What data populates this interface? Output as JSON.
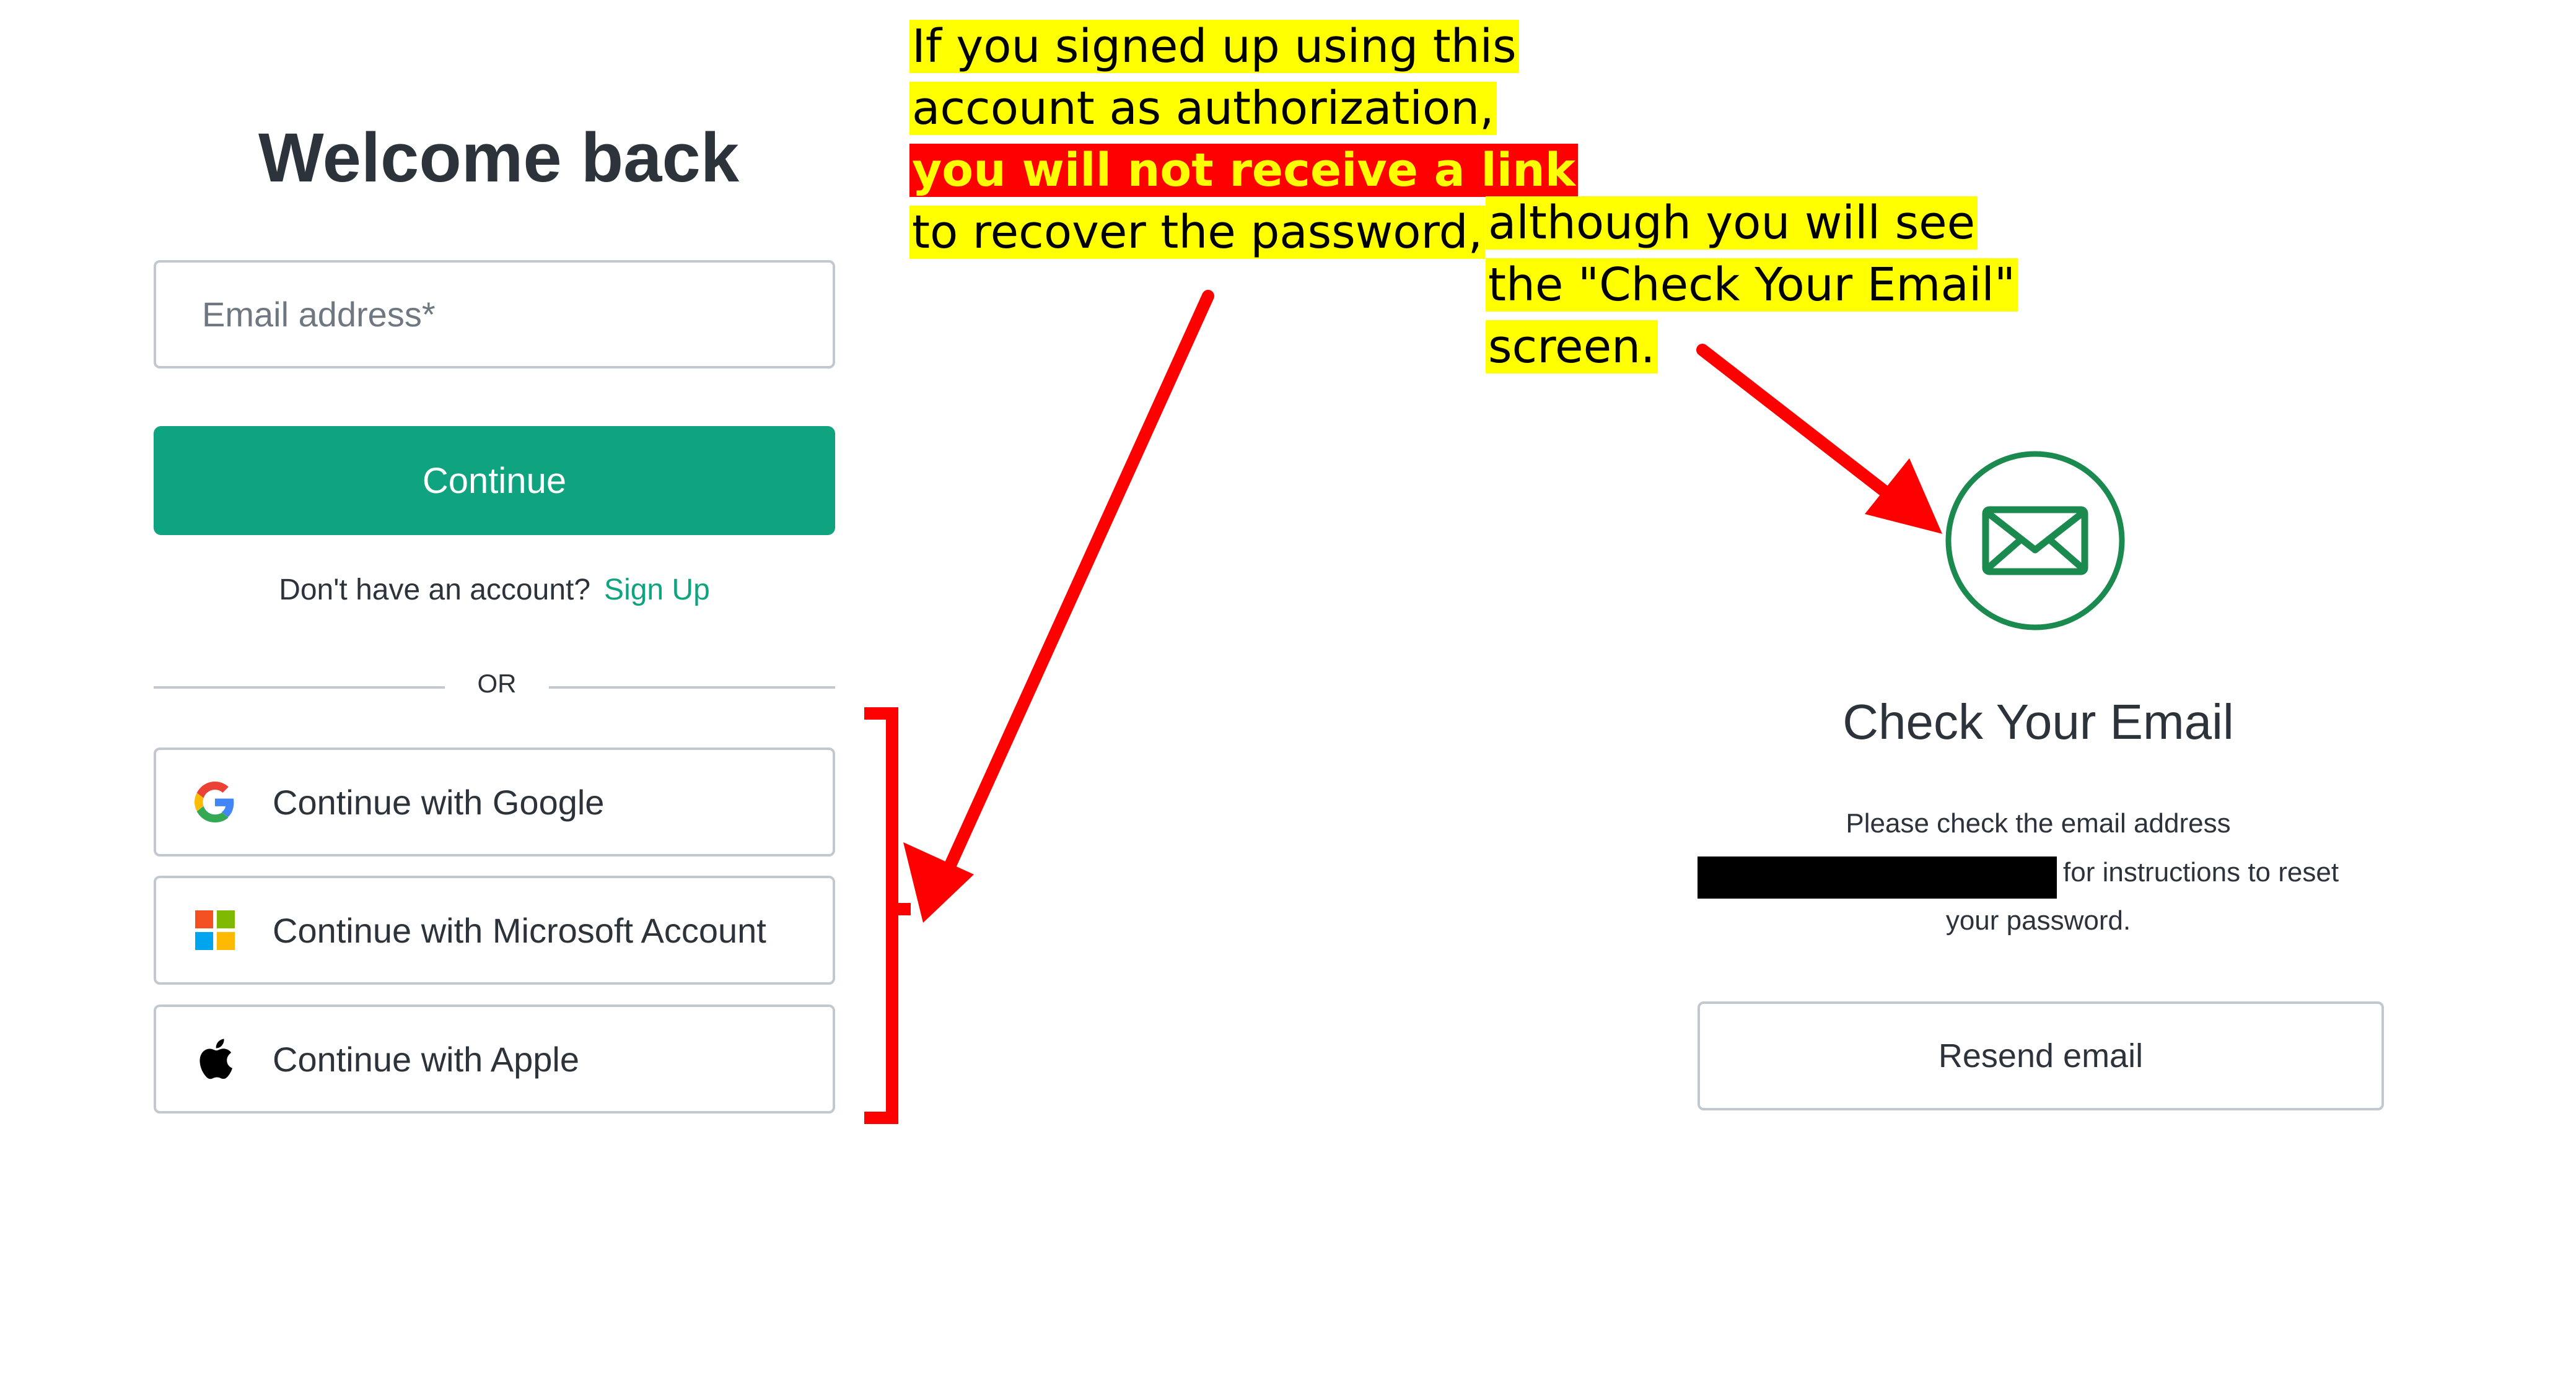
{
  "login": {
    "title": "Welcome back",
    "email_placeholder": "Email address*",
    "continue_label": "Continue",
    "no_account_text": "Don't have an account?",
    "signup_link": "Sign Up",
    "divider_text": "OR",
    "social_buttons": [
      {
        "label": "Continue with Google",
        "icon": "google-icon"
      },
      {
        "label": "Continue with Microsoft Account",
        "icon": "microsoft-icon"
      },
      {
        "label": "Continue with Apple",
        "icon": "apple-icon"
      }
    ]
  },
  "annotations": {
    "note1_lines": [
      "If you signed up using this",
      "account as authorization,",
      "you will not receive a link",
      "to recover the password,"
    ],
    "note2_lines": [
      "although you will see",
      "the \"Check Your Email\"",
      "screen."
    ]
  },
  "check_email": {
    "icon": "envelope-icon",
    "title": "Check Your Email",
    "line1": "Please check the email address",
    "line2": "for instructions to reset",
    "line3": "your password.",
    "resend_label": "Resend email"
  },
  "colors": {
    "accent": "#10a37f",
    "annotation_red": "#ff0000",
    "highlight_yellow": "#ffff00",
    "envelope_green": "#1a8a4e"
  }
}
